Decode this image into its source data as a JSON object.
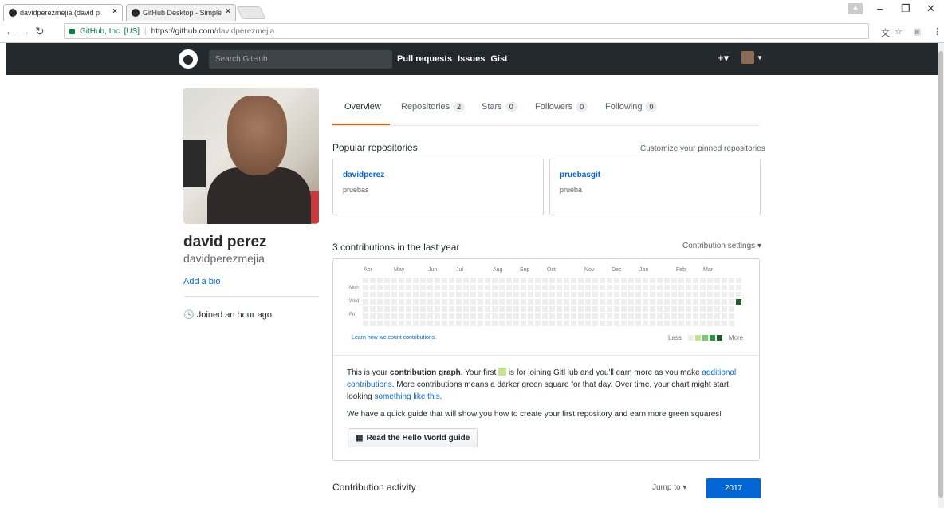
{
  "browser": {
    "tabs": [
      {
        "title": "davidperezmejia (david p"
      },
      {
        "title": "GitHub Desktop - Simple"
      }
    ],
    "secure_label": "GitHub, Inc. [US]",
    "url_host": "https://github.com",
    "url_path": "/davidperezmejia",
    "win_min": "–",
    "win_restore": "❐",
    "win_close": "✕"
  },
  "gh_header": {
    "search_placeholder": "Search GitHub",
    "nav": [
      "Pull requests",
      "Issues",
      "Gist"
    ],
    "plus": "+▾"
  },
  "profile": {
    "full_name": "david perez",
    "login": "davidperezmejia",
    "add_bio": "Add a bio",
    "joined": "Joined an hour ago"
  },
  "tabs": [
    {
      "label": "Overview",
      "count": ""
    },
    {
      "label": "Repositories",
      "count": "2"
    },
    {
      "label": "Stars",
      "count": "0"
    },
    {
      "label": "Followers",
      "count": "0"
    },
    {
      "label": "Following",
      "count": "0"
    }
  ],
  "popular": {
    "title": "Popular repositories",
    "customize": "Customize your pinned repositories",
    "repos": [
      {
        "name": "davidperez",
        "desc": "pruebas"
      },
      {
        "name": "pruebasgit",
        "desc": "prueba"
      }
    ]
  },
  "contributions": {
    "title": "3 contributions in the last year",
    "settings": "Contribution settings ▾",
    "months": [
      "Apr",
      "May",
      "Jun",
      "Jul",
      "Aug",
      "Sep",
      "Oct",
      "Nov",
      "Dec",
      "Jan",
      "Feb",
      "Mar"
    ],
    "days": [
      "Mon",
      "Wed",
      "Fri"
    ],
    "learn": "Learn how we count contributions.",
    "less": "Less",
    "more": "More",
    "colors": [
      "#eeeeee",
      "#c6e48b",
      "#7bc96f",
      "#239a3b",
      "#196127"
    ],
    "info_1": "This is your ",
    "info_bold": "contribution graph",
    "info_2": ". Your first ",
    "info_3": " is for joining GitHub and you'll earn more as you make ",
    "info_link1": "additional contributions",
    "info_4": ". More contributions means a darker green square for that day. Over time, your chart might start looking ",
    "info_link2": "something like this",
    "info_5": ".",
    "guide_text": "We have a quick guide that will show you how to create your first repository and earn more green squares!",
    "guide_button": "Read the Hello World guide"
  },
  "activity": {
    "title": "Contribution activity",
    "jump_to": "Jump to ▾",
    "year": "2017"
  }
}
